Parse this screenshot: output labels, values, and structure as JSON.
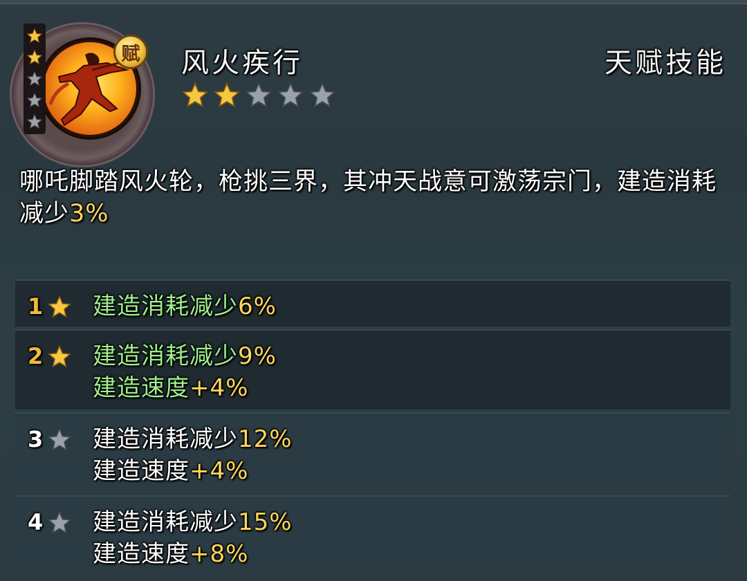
{
  "skill": {
    "badge": "赋",
    "name": "风火疾行",
    "type": "天赋技能",
    "rating": {
      "filled": 2,
      "max": 5
    },
    "icon_stars": {
      "filled": 2,
      "max": 5
    },
    "description": "哪吒脚踏风火轮，枪挑三界，其冲天战意可激荡宗门，建造消耗减少",
    "description_value": "3%"
  },
  "levels": [
    {
      "level": "1",
      "unlocked": true,
      "effects": [
        {
          "label": "建造消耗减少",
          "value": "6%"
        }
      ]
    },
    {
      "level": "2",
      "unlocked": true,
      "effects": [
        {
          "label": "建造消耗减少",
          "value": "9%"
        },
        {
          "label": "建造速度",
          "value": "+4%"
        }
      ]
    },
    {
      "level": "3",
      "unlocked": false,
      "effects": [
        {
          "label": "建造消耗减少",
          "value": "12%"
        },
        {
          "label": "建造速度",
          "value": "+4%"
        }
      ]
    },
    {
      "level": "4",
      "unlocked": false,
      "effects": [
        {
          "label": "建造消耗减少",
          "value": "15%"
        },
        {
          "label": "建造速度",
          "value": "+8%"
        }
      ]
    }
  ],
  "colors": {
    "star_gold": "#f5c842",
    "star_grey": "#9aa2a8",
    "value_gold": "#ffd75a",
    "effect_green": "#9ef08c"
  }
}
